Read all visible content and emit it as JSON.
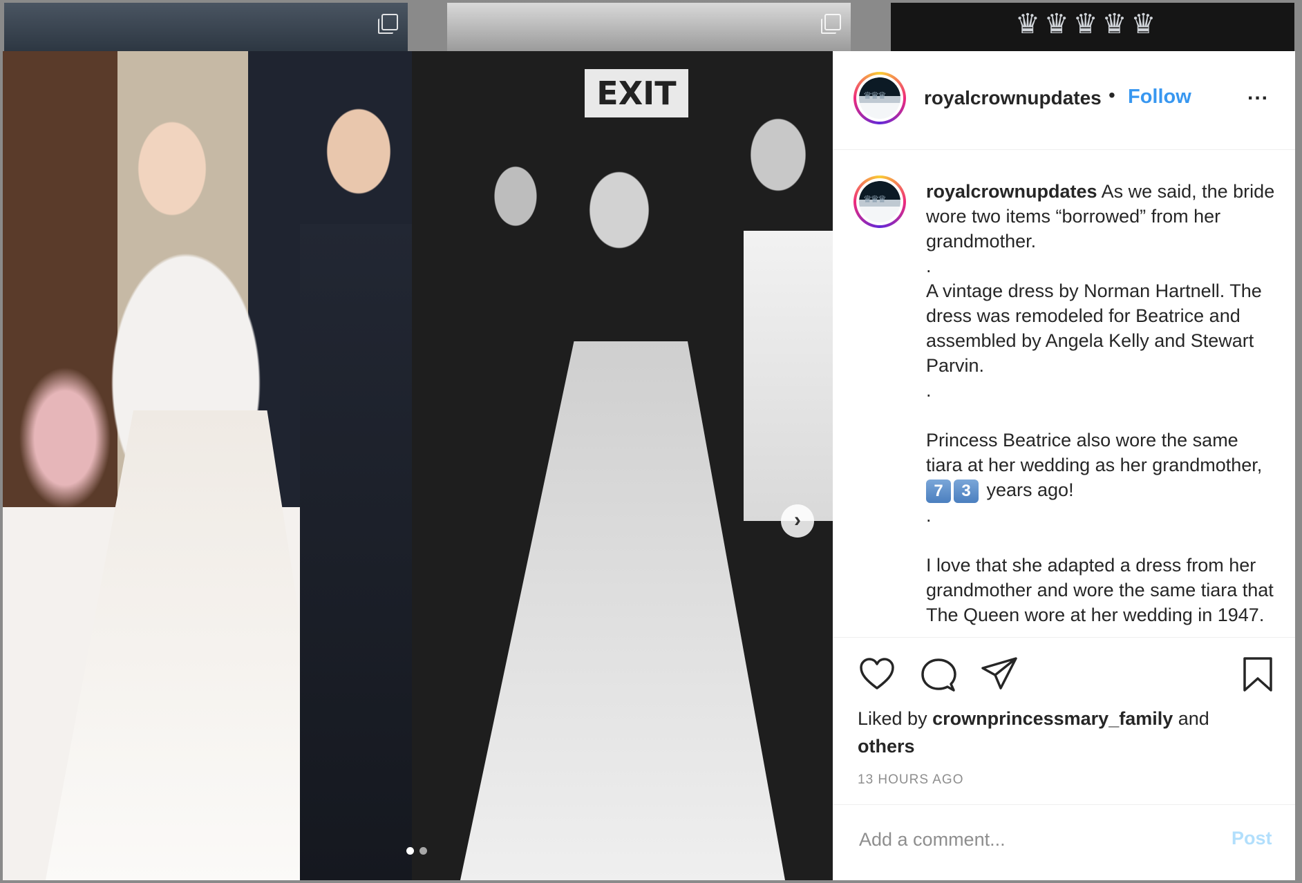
{
  "post": {
    "username": "royalcrownupdates",
    "separator": "•",
    "follow_label": "Follow",
    "more_label": "...",
    "caption": {
      "username": "royalcrownupdates",
      "line1": " As we said, the bride wore two items “borrowed” from her grandmother.\n.\nA vintage dress by Norman Hartnell. The dress was remodeled for Beatrice and assembled by Angela Kelly and Stewart Parvin.\n.\n\nPrincess Beatrice also wore the same tiara at her wedding as her grandmother, ",
      "emoji_1": "7",
      "emoji_2": "3",
      "line2": " years ago!\n.\n\nI love that she adapted a dress from her grandmother and wore the same tiara that The Queen wore at her wedding in 1947."
    },
    "liked_by_prefix": "Liked by ",
    "liked_by_user": "crownprincessmary_family",
    "liked_by_mid": " and",
    "liked_by_others": "others",
    "timestamp": "13 HOURS AGO",
    "comment_placeholder": "Add a comment...",
    "post_label": "Post",
    "exit_sign": "EXIT",
    "next_label": "›",
    "carousel": {
      "count": 2,
      "active": 0
    }
  },
  "icons": [
    "multi-photo-icon",
    "heart-icon",
    "comment-icon",
    "share-icon",
    "bookmark-icon",
    "chevron-right-icon",
    "more-icon"
  ],
  "colors": {
    "link": "#3897f0",
    "post_disabled": "#b2dffc",
    "text": "#262626",
    "muted": "#8e8e8e"
  }
}
